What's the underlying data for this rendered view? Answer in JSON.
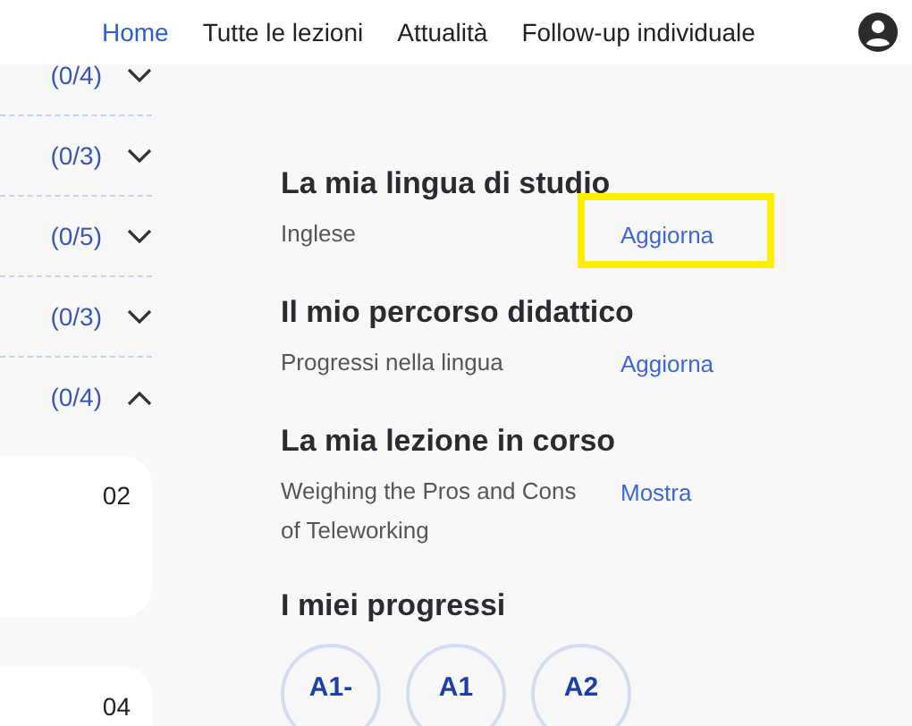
{
  "nav": {
    "items": [
      {
        "label": "Home",
        "selected": true
      },
      {
        "label": "Tutte le lezioni",
        "selected": false
      },
      {
        "label": "Attualità",
        "selected": false
      },
      {
        "label": "Follow-up individuale",
        "selected": false
      }
    ]
  },
  "sidebar": {
    "items": [
      {
        "count": "(0/4)",
        "expanded": false
      },
      {
        "count": "(0/3)",
        "expanded": false
      },
      {
        "count": "(0/5)",
        "expanded": false
      },
      {
        "count": "(0/3)",
        "expanded": false
      },
      {
        "count": "(0/4)",
        "expanded": true
      }
    ],
    "cards": [
      {
        "number": "02"
      },
      {
        "number": "04"
      }
    ]
  },
  "sections": [
    {
      "title": "La mia lingua di studio",
      "text": "Inglese",
      "action": "Aggiorna",
      "highlighted": true
    },
    {
      "title": "Il mio percorso didattico",
      "text": "Progressi nella lingua",
      "action": "Aggiorna",
      "highlighted": false
    },
    {
      "title": "La mia lezione in corso",
      "text": "Weighing the Pros and Cons of Teleworking",
      "action": "Mostra",
      "highlighted": false
    }
  ],
  "progress": {
    "title": "I miei progressi",
    "levels": [
      "A1-",
      "A1",
      "A2"
    ]
  }
}
